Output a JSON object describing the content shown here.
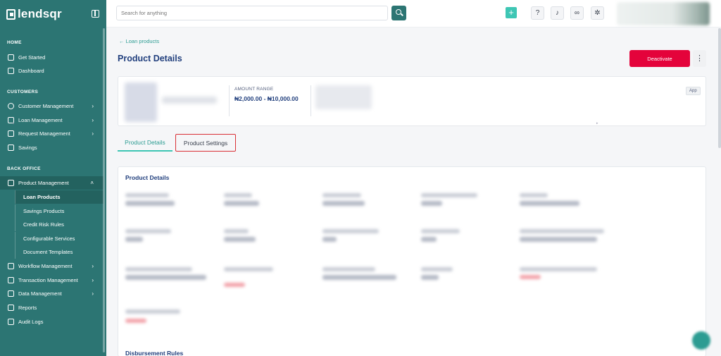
{
  "brand": {
    "name": "lendsqr"
  },
  "search": {
    "placeholder": "Search for anything"
  },
  "sidebar": {
    "sections": [
      {
        "title": "HOME",
        "items": [
          {
            "label": "Get Started"
          },
          {
            "label": "Dashboard"
          }
        ]
      },
      {
        "title": "CUSTOMERS",
        "items": [
          {
            "label": "Customer Management",
            "has_children": true
          },
          {
            "label": "Loan Management",
            "has_children": true
          },
          {
            "label": "Request Management",
            "has_children": true
          },
          {
            "label": "Savings"
          }
        ]
      },
      {
        "title": "BACK OFFICE",
        "items": [
          {
            "label": "Product Management",
            "expanded": true
          },
          {
            "label": "Workflow Management",
            "has_children": true
          },
          {
            "label": "Transaction Management",
            "has_children": true
          },
          {
            "label": "Data Management",
            "has_children": true
          },
          {
            "label": "Reports"
          },
          {
            "label": "Audit Logs"
          }
        ]
      }
    ],
    "product_management_children": [
      {
        "label": "Loan Products",
        "active": true
      },
      {
        "label": "Savings Products"
      },
      {
        "label": "Credit Risk Rules"
      },
      {
        "label": "Configurable Services"
      },
      {
        "label": "Document Templates"
      }
    ]
  },
  "topbar": {
    "icons": [
      "plus-icon",
      "help-book-icon",
      "bell-icon",
      "link-icon",
      "gear-icon"
    ]
  },
  "main": {
    "back_link": "← Loan products",
    "title": "Product Details",
    "deactivate_label": "Deactivate",
    "kebab": "⋮",
    "summary": {
      "amount_label": "AMOUNT RANGE",
      "amount_value": "₦2,000.00 - ₦10,000.00",
      "badge": "App"
    },
    "tabs": [
      {
        "label": "Product Details",
        "active": true
      },
      {
        "label": "Product Settings",
        "highlighted": true
      }
    ],
    "card_title": "Product Details",
    "next_section_title": "Disbursement Rules"
  },
  "colors": {
    "sidebar": "#2c7573",
    "accent": "#3ec6b4",
    "danger": "#e4033b",
    "title": "#213f7d"
  }
}
